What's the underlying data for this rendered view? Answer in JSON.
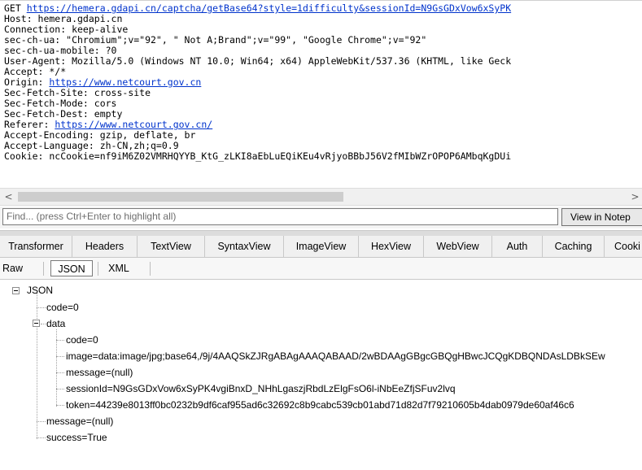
{
  "raw_request": {
    "request_line": {
      "method": "GET ",
      "url": "https://hemera.gdapi.cn/captcha/getBase64?style=1difficulty&sessionId=N9GsGDxVow6xSyPK"
    },
    "headers": [
      {
        "text": "Host: hemera.gdapi.cn"
      },
      {
        "text": "Connection: keep-alive"
      },
      {
        "text": "sec-ch-ua: \"Chromium\";v=\"92\", \" Not A;Brand\";v=\"99\", \"Google Chrome\";v=\"92\""
      },
      {
        "text": "sec-ch-ua-mobile: ?0"
      },
      {
        "text": "User-Agent: Mozilla/5.0 (Windows NT 10.0; Win64; x64) AppleWebKit/537.36 (KHTML, like Geck"
      },
      {
        "text": "Accept: */*"
      },
      {
        "prefix": "Origin: ",
        "link": "https://www.netcourt.gov.cn"
      },
      {
        "text": "Sec-Fetch-Site: cross-site"
      },
      {
        "text": "Sec-Fetch-Mode: cors"
      },
      {
        "text": "Sec-Fetch-Dest: empty"
      },
      {
        "prefix": "Referer: ",
        "link": "https://www.netcourt.gov.cn/"
      },
      {
        "text": "Accept-Encoding: gzip, deflate, br"
      },
      {
        "text": "Accept-Language: zh-CN,zh;q=0.9"
      },
      {
        "text": "Cookie: ncCookie=nf9iM6Z02VMRHQYYB_KtG_zLKI8aEbLuEQiKEu4vRjyoBBbJ56V2fMIbWZrOPOP6AMbqKgDUi"
      }
    ]
  },
  "scrollbar": {
    "left_arrow": "<",
    "right_arrow": ">"
  },
  "find_bar": {
    "placeholder": "Find... (press Ctrl+Enter to highlight all)",
    "view_button": "View in Notep"
  },
  "response_tabs": [
    "Transformer",
    "Headers",
    "TextView",
    "SyntaxView",
    "ImageView",
    "HexView",
    "WebView",
    "Auth",
    "Caching",
    "Cooki"
  ],
  "sub_tabs": {
    "raw": "Raw",
    "json": "JSON",
    "xml": "XML",
    "active": "JSON"
  },
  "tree": {
    "root": "JSON",
    "code": "code=0",
    "data": "data",
    "data_code": "code=0",
    "data_image": "image=data:image/jpg;base64,/9j/4AAQSkZJRgABAgAAAQABAAD/2wBDAAgGBgcGBQgHBwcJCQgKDBQNDAsLDBkSEw",
    "data_message": "message=(null)",
    "data_sessionId": "sessionId=N9GsGDxVow6xSyPK4vgiBnxD_NHhLgaszjRbdLzElgFsO6l-iNbEeZfjSFuv2lvq",
    "data_token": "token=44239e8013ff0bc0232b9df6caf955ad6c32692c8b9cabc539cb01abd71d82d7f79210605b4dab0979de60af46c6",
    "message": "message=(null)",
    "success": "success=True"
  },
  "colors": {
    "link": "#0033cc",
    "background": "#ffffff",
    "panel": "#f0f0f0"
  }
}
